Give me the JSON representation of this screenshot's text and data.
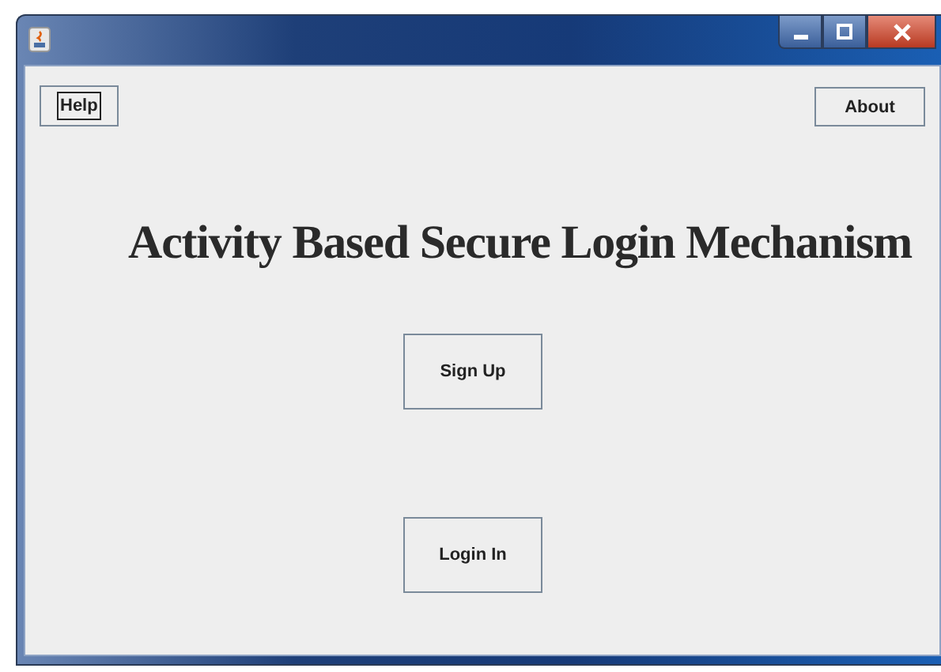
{
  "window": {
    "controls": [
      {
        "kind": "minimize"
      },
      {
        "kind": "maximize"
      },
      {
        "kind": "close"
      }
    ]
  },
  "top_buttons": [
    {
      "label": "Help",
      "focused": true
    },
    {
      "label": "About",
      "focused": false
    }
  ],
  "heading": "Activity Based Secure Login Mechanism",
  "main_buttons": [
    {
      "label": "Sign Up",
      "focused": false
    },
    {
      "label": "Login In",
      "focused": false
    }
  ]
}
